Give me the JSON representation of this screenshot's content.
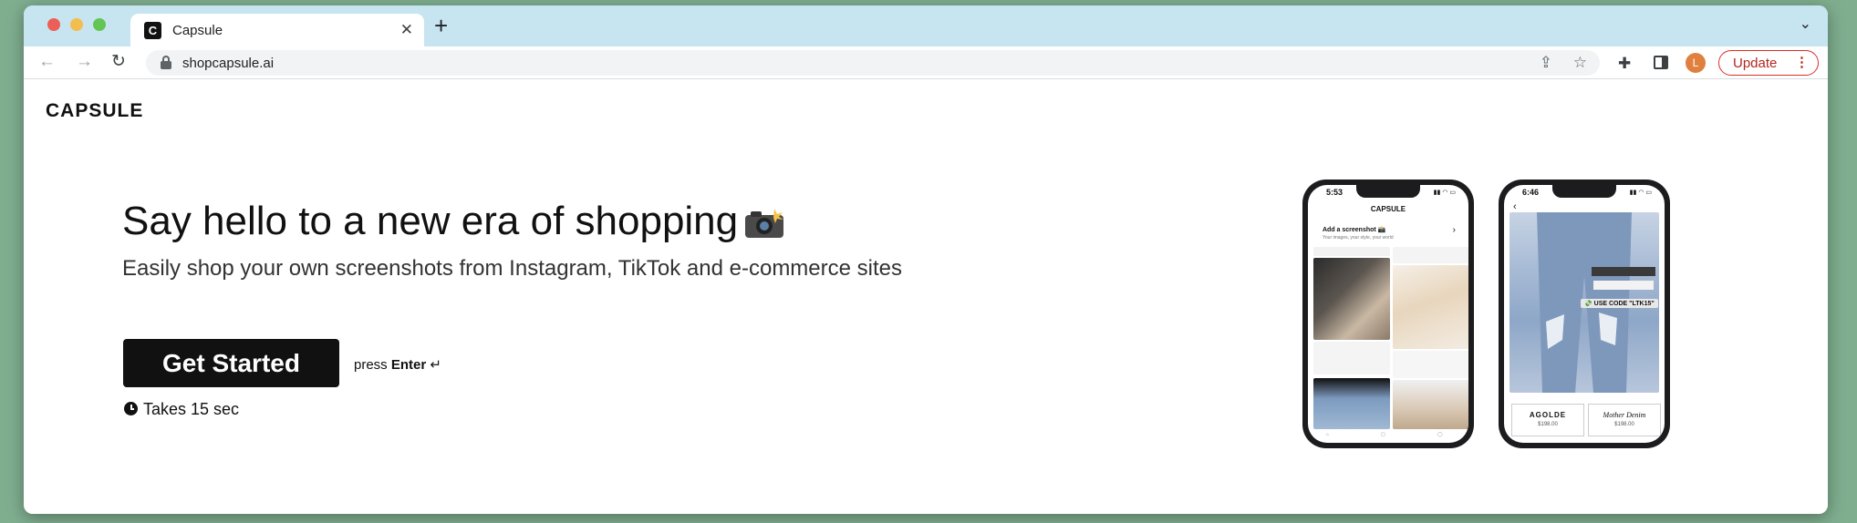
{
  "browser": {
    "tab_title": "Capsule",
    "tab_favicon": "C",
    "url": "shopcapsule.ai",
    "update_label": "Update",
    "avatar_initial": "L",
    "accent_update": "#d93025"
  },
  "page": {
    "logo": "CAPSULE",
    "headline": "Say hello to a new era of shopping",
    "subhead": "Easily shop your own screenshots from Instagram, TikTok and e-commerce sites",
    "cta_label": "Get Started",
    "press_prefix": "press",
    "press_key": "Enter",
    "press_symbol": "↵",
    "time_note": "Takes 15 sec"
  },
  "phone_left": {
    "time": "5:53",
    "app_title": "CAPSULE",
    "add_screenshot": "Add a screenshot 📸",
    "add_sub": "Your images, your style, your world"
  },
  "phone_right": {
    "time": "6:46",
    "code_chip": "💸 USE CODE \"LTK15\"",
    "product_1_brand": "AGOLDE",
    "product_1_price": "$198.00",
    "product_2_brand": "Mother Denim",
    "product_2_price": "$198.00"
  }
}
